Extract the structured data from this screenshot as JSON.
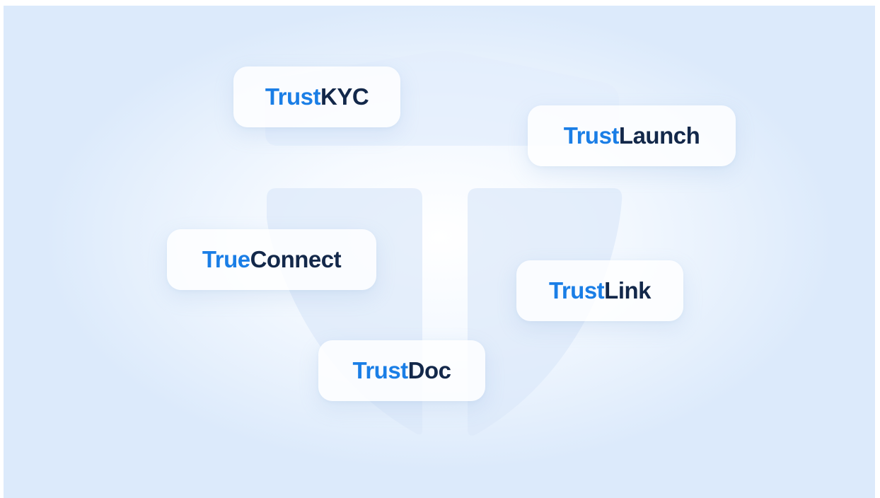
{
  "colors": {
    "prefix": "#1a7ee6",
    "suffix": "#13284a",
    "background": "#dceafb",
    "shield": "#d6e6fa"
  },
  "background_icon": "shield-t-logo-icon",
  "products": [
    {
      "prefix": "Trust",
      "suffix": "KYC"
    },
    {
      "prefix": "Trust",
      "suffix": "Launch"
    },
    {
      "prefix": "True",
      "suffix": "Connect"
    },
    {
      "prefix": "Trust",
      "suffix": "Link"
    },
    {
      "prefix": "Trust",
      "suffix": "Doc"
    }
  ]
}
